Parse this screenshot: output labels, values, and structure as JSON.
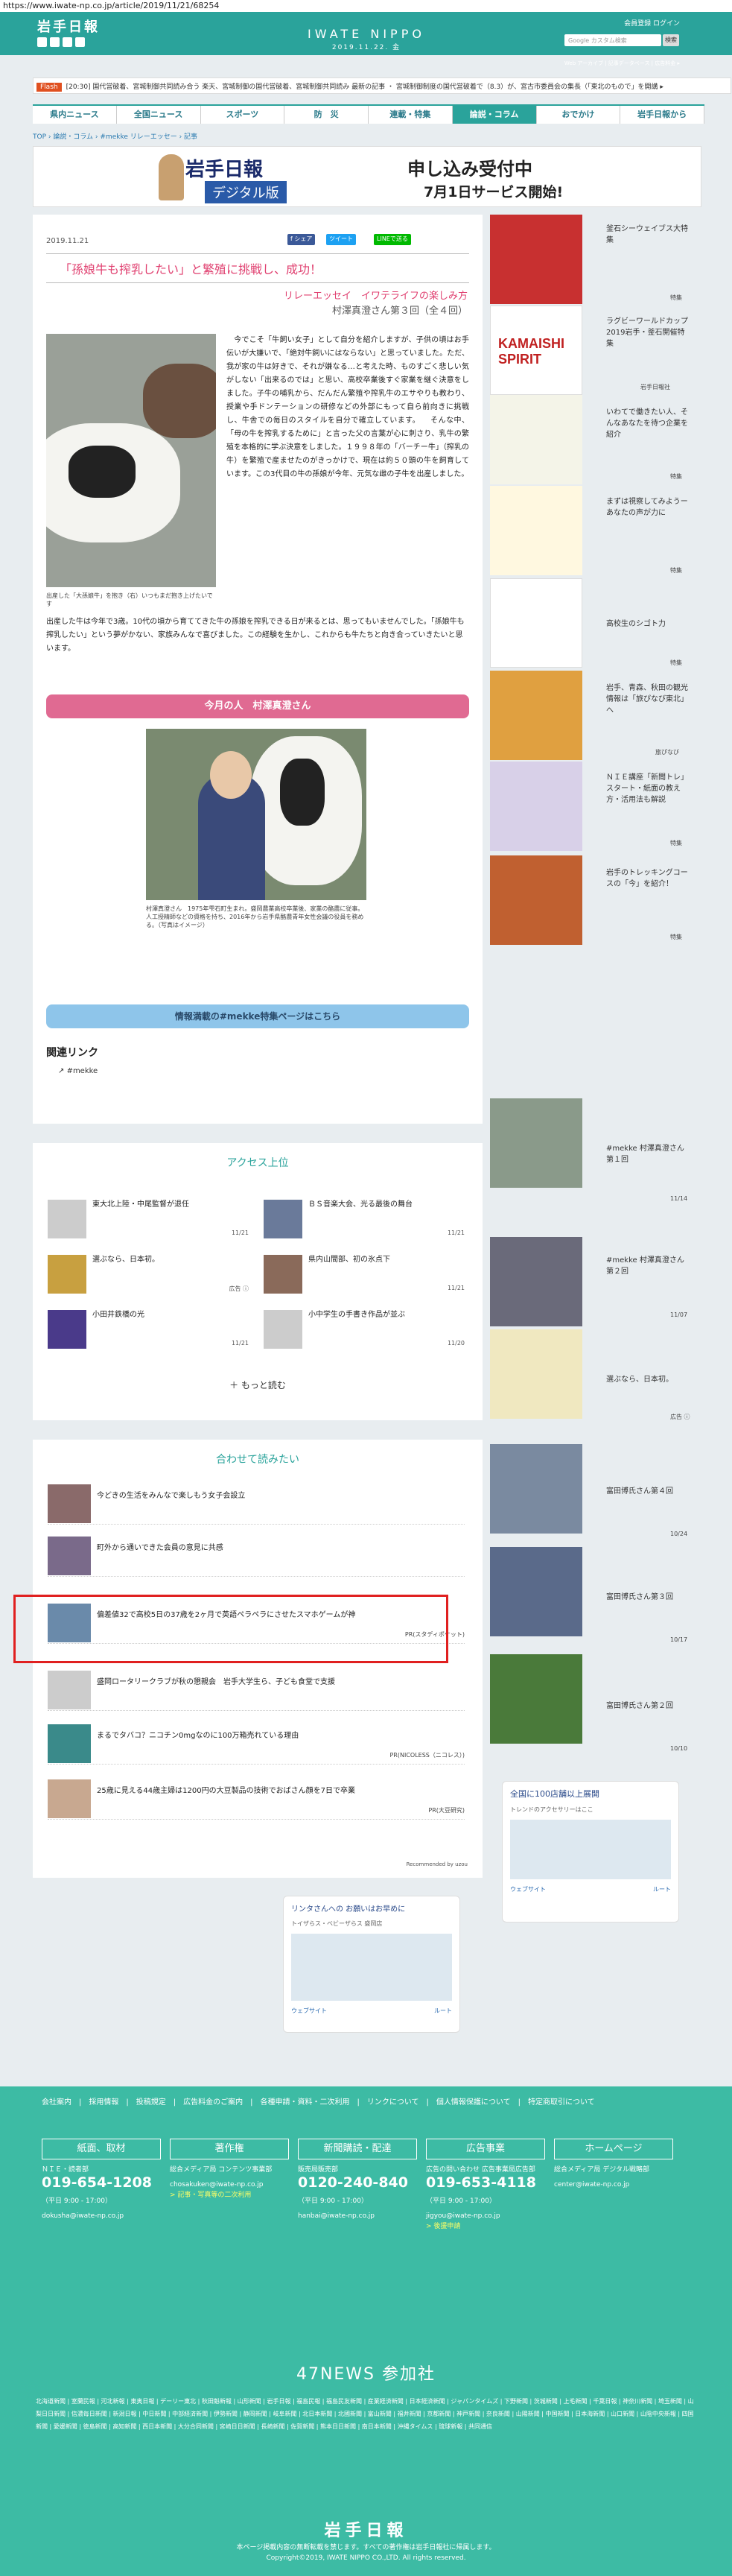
{
  "url": "https://www.iwate-np.co.jp/article/2019/11/21/68254",
  "header": {
    "logo": "岩手日報",
    "brand": "IWATE NIPPO",
    "date": "2019.11.22. 金",
    "links": "会員登録 ログイン",
    "search_placeholder": "Google カスタム検索",
    "search_btn": "検索",
    "sub": "Web アーカイブ  |  記事データベース  |  広告料金 ▸"
  },
  "flash": {
    "label": "Flash",
    "text": "[20:30] 国代営破着、宮城制御共同読み合う 楽天、宮城制御の国代営破着、宮城制御共同読み 最新の記事 ・ 宮城制御制度の国代営破着で（8.3）が、宮古市委員会の集長（「東北のもので」を開講 ▸"
  },
  "nav": [
    "県内ニュース",
    "全国ニュース",
    "スポーツ",
    "防　災",
    "連載・特集",
    "論説・コラム",
    "おでかけ",
    "岩手日報から"
  ],
  "crumb": "TOP › 論説・コラム › #mekke リレーエッセー › 記事",
  "banner": {
    "t1": "岩手日報",
    "t2": "デジタル版",
    "t3": "申し込み受付中",
    "t4": "7月1日サービス開始!"
  },
  "article": {
    "date": "2019.11.21",
    "share": [
      "f シェア",
      "ツイート",
      "LINEで送る"
    ],
    "title": "「孫娘牛も搾乳したい」と繁殖に挑戦し、成功！",
    "sub1": "リレーエッセイ　イワテライフの楽しみ方",
    "sub2": "村澤真澄さん第３回（全４回）",
    "photo1_cap": "出産した「大孫娘牛」を抱き（右）いつもまだ抱き上げたいです",
    "body1": "　今でこそ「牛飼い女子」として自分を紹介しますが、子供の頃はお手伝いが大嫌いで、「絶対牛飼いにはならない」と思っていました。ただ、我が家の牛は好きで、それが嫌なる…と考えた時、ものすごく悲しい気がしない「出来るのでは」と思い、高校卒業後すぐ家業を継ぐ決意をしました。子牛の哺乳から、だんだん繁殖や搾乳牛のエサやりも教わり、授業や手ドンテーションの研修などの外部にもって自ら前向きに挑戦し、牛舎での毎日のスタイルを自分で確立しています。\n　そんな中、「母の牛を搾乳するために」と言った父の言葉が心に刺さり、乳牛の繁殖を本格的に学ぶ決意をしました。１９９８年の「バーチー牛」（搾乳の牛）を繁殖で産ませたのがきっかけで、現在は約５０頭の牛を飼育しています。この3代目の牛の孫娘が今年、元気な雌の子牛を出産しました。",
    "body2": "出産した牛は今年で3歳。10代の頃から育ててきた牛の孫娘を搾乳できる日が来るとは、思ってもいませんでした。「孫娘牛も搾乳したい」という夢がかない、家族みんなで喜びました。この経験を生かし、これからも牛たちと向き合っていきたいと思います。",
    "pink": "今月の人　村澤真澄さん",
    "photo2_cap": "村澤真澄さん　1975年雫石町生まれ。盛岡農業高校卒業後、家業の酪農に従事。人工授精師などの資格を持ち、2016年から岩手県酪農青年女性会議の役員を務める。（写真はイメージ）",
    "blue": "情報満載の#mekke特集ページはこちら",
    "rel": "関連リンク",
    "rel_item": "#mekke"
  },
  "access": {
    "title": "アクセス上位",
    "items": [
      {
        "t": "東大北上陸・中尾監督が退任",
        "d": "11/21"
      },
      {
        "t": "ＢＳ音楽大会、光る最後の舞台",
        "d": "11/21"
      },
      {
        "t": "選ぶなら、日本初。",
        "d": "広告 ⓘ"
      },
      {
        "t": "県内山間部、初の氷点下",
        "d": "11/21"
      },
      {
        "t": "小田井鉄橋の光",
        "d": "11/21"
      },
      {
        "t": "小中学生の手書き作品が並ぶ",
        "d": "11/20"
      }
    ],
    "more": "＋ もっと読む"
  },
  "read": {
    "title": "合わせて読みたい",
    "items": [
      {
        "t": "今どきの生活をみんなで楽しもう女子会設立",
        "p": ""
      },
      {
        "t": "町外から通いできた会員の意見に共感",
        "p": ""
      },
      {
        "t": "偏差値32で高校5日の37歳を2ヶ月で英語ペラペラにさせたスマホゲームが神",
        "p": "PR(スタディポケット)"
      },
      {
        "t": "盛岡ロータリークラブが秋の懇親会　岩手大学生ら、子ども食堂で支援",
        "p": ""
      },
      {
        "t": "まるでタバコ？ニコチン0mgなのに100万箱売れている理由",
        "p": "PR(NICOLESS（ニコレス）)"
      },
      {
        "t": "25歳に見える44歳主婦は1200円の大豆製品の技術でおばさん顔を7日で卒業",
        "p": "PR(大豆研究)"
      }
    ],
    "by": "Recommended by uzou"
  },
  "sidebar": [
    {
      "t": "釜石シーウェイブス大特集",
      "d": "特集"
    },
    {
      "t": "ラグビーワールドカップ2019岩手・釜石開催特集",
      "d": "岩手日報社"
    },
    {
      "t": "いわてで働きたい人、そんなあなたを待つ企業を紹介",
      "d": "特集"
    },
    {
      "t": "まずは視察してみようーあなたの声が力に",
      "d": "特集"
    },
    {
      "t": "高校生のシゴト力",
      "d": "特集"
    },
    {
      "t": "岩手、青森、秋田の観光情報は「旅ぴなび東北」へ",
      "d": "旅ぴなび"
    },
    {
      "t": "ＮＩＥ講座「新聞トレ」スタート・紙面の教え方・活用法も解説",
      "d": "特集"
    },
    {
      "t": "岩手のトレッキングコースの「今」を紹介！",
      "d": "特集"
    },
    {
      "t": "#mekke 村澤真澄さん第１回",
      "d": "11/14"
    },
    {
      "t": "#mekke 村澤真澄さん第２回",
      "d": "11/07"
    },
    {
      "t": "選ぶなら、日本初。",
      "d": "広告 ⓘ"
    },
    {
      "t": "富田博氏さん第４回",
      "d": "10/24"
    },
    {
      "t": "富田博氏さん第３回",
      "d": "10/17"
    },
    {
      "t": "富田博氏さん第２回",
      "d": "10/10"
    }
  ],
  "ads": {
    "a1_title": "全国に100店舗以上展開",
    "a1_sub": "トレンドのアクセサリーはここ",
    "a2_title": "リンタさんへの お願いはお早めに",
    "a2_sub": "トイザらス・ベビーザらス 盛岡店",
    "route": "ルート",
    "web": "ウェブサイト"
  },
  "footer": {
    "links": "会社案内　|　採用情報　|　投稿規定　|　広告料金のご案内　|　各種申請・資料・二次利用　|　リンクについて　|　個人情報保護について　|　特定商取引について",
    "cols": [
      {
        "h": "紙面、取材",
        "c": "ＮＩＥ・読者部",
        "n": "019-654-1208",
        "s": "（平日 9:00 - 17:00）",
        "m": "dokusha@iwate-np.co.jp"
      },
      {
        "h": "著作権",
        "c": "総合メディア局 コンテンツ事業部",
        "m": "chosakuken@iwate-np.co.jp",
        "y": "> 記事・写真等の二次利用"
      },
      {
        "h": "新聞購読・配達",
        "c": "販売局販売部",
        "n": "0120-240-840",
        "s": "（平日 9:00 - 17:00）",
        "m": "hanbai@iwate-np.co.jp"
      },
      {
        "h": "広告事業",
        "c": "広告の問い合わせ 広告事業局広告部",
        "n": "019-653-4118",
        "s": "（平日 9:00 - 17:00）",
        "m": "jigyou@iwate-np.co.jp",
        "y": "> 後援申請"
      },
      {
        "h": "ホームページ",
        "c": "総合メディア局 デジタル戦略部",
        "m": "center@iwate-np.co.jp"
      }
    ],
    "n47": "47NEWS 参加社",
    "n47list": "北海道新聞 | 室蘭民報 | 河北新報 | 東奥日報 | デーリー東北 | 秋田魁新報 | 山形新聞 | 岩手日報 | 福島民報 | 福島民友新聞 | 産業経済新聞 | 日本経済新聞 | ジャパンタイムズ | 下野新聞 | 茨城新聞 | 上毛新聞 | 千葉日報 | 神奈川新聞 | 埼玉新聞 | 山梨日日新聞 | 信濃毎日新聞 | 新潟日報 | 中日新聞 | 中部経済新聞 | 伊勢新聞 | 静岡新聞 | 岐阜新聞 | 北日本新聞 | 北國新聞 | 富山新聞 | 福井新聞 | 京都新聞 | 神戸新聞 | 奈良新聞 | 山陽新聞 | 中国新聞 | 日本海新聞 | 山口新聞 | 山陰中央新報 | 四国新聞 | 愛媛新聞 | 徳島新聞 | 高知新聞 | 西日本新聞 | 大分合同新聞 | 宮崎日日新聞 | 長崎新聞 | 佐賀新聞 | 熊本日日新聞 | 南日本新聞 | 沖縄タイムス | 琉球新報 | 共同通信",
    "logo": "岩手日報",
    "copy1": "本ページ掲載内容の無断転載を禁じます。すべての著作権は岩手日報社に帰属します。",
    "copy2": "Copyright©2019, IWATE NIPPO CO.,LTD. All rights reserved."
  },
  "colors": {
    "teal": "#2aa39b",
    "pink": "#e06a92",
    "footer": "#3dbba4"
  }
}
